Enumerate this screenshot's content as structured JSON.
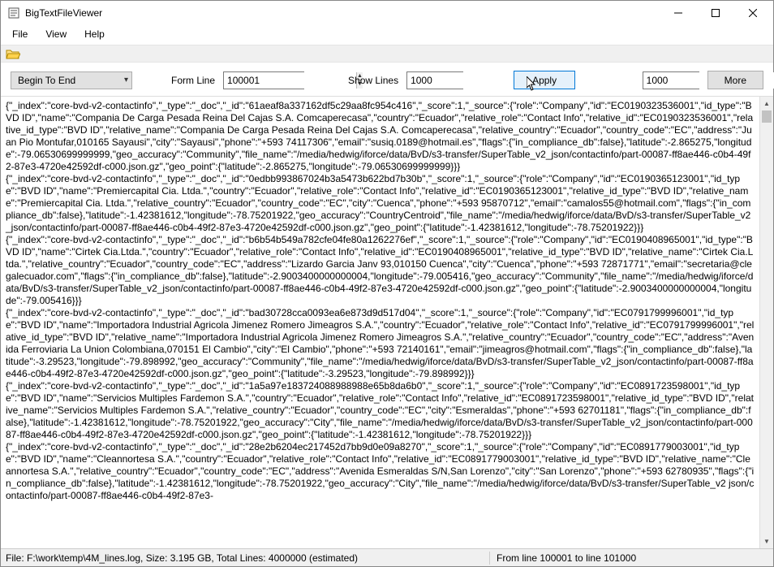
{
  "window": {
    "title": "BigTextFileViewer"
  },
  "menu": {
    "file": "File",
    "view": "View",
    "help": "Help"
  },
  "controls": {
    "direction_selected": "Begin To End",
    "form_line_label": "Form Line",
    "form_line_value": "100001",
    "show_lines_label": "Show Lines",
    "show_lines_value": "1000",
    "apply_label": "Apply",
    "right_spinner_value": "1000",
    "more_label": "More"
  },
  "content_text": "{\"_index\":\"core-bvd-v2-contactinfo\",\"_type\":\"_doc\",\"_id\":\"61aeaf8a337162df5c29aa8fc954c416\",\"_score\":1,\"_source\":{\"role\":\"Company\",\"id\":\"EC0190323536001\",\"id_type\":\"BVD ID\",\"name\":\"Compania De Carga Pesada Reina Del Cajas S.A. Comcaperecasa\",\"country\":\"Ecuador\",\"relative_role\":\"Contact Info\",\"relative_id\":\"EC0190323536001\",\"relative_id_type\":\"BVD ID\",\"relative_name\":\"Compania De Carga Pesada Reina Del Cajas S.A. Comcaperecasa\",\"relative_country\":\"Ecuador\",\"country_code\":\"EC\",\"address\":\"Juan Pio Montufar,010165 Sayausi\",\"city\":\"Sayausi\",\"phone\":\"+593 74117306\",\"email\":\"susiq.0189@hotmail.es\",\"flags\":{\"in_compliance_db\":false},\"latitude\":-2.865275,\"longitude\":-79.06530699999999,\"geo_accuracy\":\"Community\",\"file_name\":\"/media/hedwig/iforce/data/BvD/s3-transfer/SuperTable_v2_json/contactinfo/part-00087-ff8ae446-c0b4-49f2-87e3-4720e42592df-c000.json.gz\",\"geo_point\":{\"latitude\":-2.865275,\"longitude\":-79.06530699999999}}}\n{\"_index\":\"core-bvd-v2-contactinfo\",\"_type\":\"_doc\",\"_id\":\"0edbb993867024b3a5473b622bd7b30b\",\"_score\":1,\"_source\":{\"role\":\"Company\",\"id\":\"EC0190365123001\",\"id_type\":\"BVD ID\",\"name\":\"Premiercapital Cia. Ltda.\",\"country\":\"Ecuador\",\"relative_role\":\"Contact Info\",\"relative_id\":\"EC0190365123001\",\"relative_id_type\":\"BVD ID\",\"relative_name\":\"Premiercapital Cia. Ltda.\",\"relative_country\":\"Ecuador\",\"country_code\":\"EC\",\"city\":\"Cuenca\",\"phone\":\"+593 95870712\",\"email\":\"camalos55@hotmail.com\",\"flags\":{\"in_compliance_db\":false},\"latitude\":-1.42381612,\"longitude\":-78.75201922,\"geo_accuracy\":\"CountryCentroid\",\"file_name\":\"/media/hedwig/iforce/data/BvD/s3-transfer/SuperTable_v2_json/contactinfo/part-00087-ff8ae446-c0b4-49f2-87e3-4720e42592df-c000.json.gz\",\"geo_point\":{\"latitude\":-1.42381612,\"longitude\":-78.75201922}}}\n{\"_index\":\"core-bvd-v2-contactinfo\",\"_type\":\"_doc\",\"_id\":\"b6b54b549a782cfe04fe80a1262276ef\",\"_score\":1,\"_source\":{\"role\":\"Company\",\"id\":\"EC0190408965001\",\"id_type\":\"BVD ID\",\"name\":\"Cirtek Cia.Ltda.\",\"country\":\"Ecuador\",\"relative_role\":\"Contact Info\",\"relative_id\":\"EC0190408965001\",\"relative_id_type\":\"BVD ID\",\"relative_name\":\"Cirtek Cia.Ltda.\",\"relative_country\":\"Ecuador\",\"country_code\":\"EC\",\"address\":\"Lizardo Garcia Janv 93,010150 Cuenca\",\"city\":\"Cuenca\",\"phone\":\"+593 72871771\",\"email\":\"secretaria@clegalecuador.com\",\"flags\":{\"in_compliance_db\":false},\"latitude\":-2.9003400000000004,\"longitude\":-79.005416,\"geo_accuracy\":\"Community\",\"file_name\":\"/media/hedwig/iforce/data/BvD/s3-transfer/SuperTable_v2_json/contactinfo/part-00087-ff8ae446-c0b4-49f2-87e3-4720e42592df-c000.json.gz\",\"geo_point\":{\"latitude\":-2.9003400000000004,\"longitude\":-79.005416}}}\n{\"_index\":\"core-bvd-v2-contactinfo\",\"_type\":\"_doc\",\"_id\":\"bad30728cca0093ea6e873d9d517d04\",\"_score\":1,\"_source\":{\"role\":\"Company\",\"id\":\"EC0791799996001\",\"id_type\":\"BVD ID\",\"name\":\"Importadora Industrial Agricola Jimenez Romero Jimeagros S.A.\",\"country\":\"Ecuador\",\"relative_role\":\"Contact Info\",\"relative_id\":\"EC0791799996001\",\"relative_id_type\":\"BVD ID\",\"relative_name\":\"Importadora Industrial Agricola Jimenez Romero Jimeagros S.A.\",\"relative_country\":\"Ecuador\",\"country_code\":\"EC\",\"address\":\"Avenida Ferroviaria La Union Colombiana,070151 El Cambio\",\"city\":\"El Cambio\",\"phone\":\"+593 72140161\",\"email\":\"jimeagros@hotmail.com\",\"flags\":{\"in_compliance_db\":false},\"latitude\":-3.29523,\"longitude\":-79.898992,\"geo_accuracy\":\"Community\",\"file_name\":\"/media/hedwig/iforce/data/BvD/s3-transfer/SuperTable_v2_json/contactinfo/part-00087-ff8ae446-c0b4-49f2-87e3-4720e42592df-c000.json.gz\",\"geo_point\":{\"latitude\":-3.29523,\"longitude\":-79.898992}}}\n{\"_index\":\"core-bvd-v2-contactinfo\",\"_type\":\"_doc\",\"_id\":\"1a5a97e183724088988988e65b8da6b0\",\"_score\":1,\"_source\":{\"role\":\"Company\",\"id\":\"EC0891723598001\",\"id_type\":\"BVD ID\",\"name\":\"Servicios Multiples Fardemon S.A.\",\"country\":\"Ecuador\",\"relative_role\":\"Contact Info\",\"relative_id\":\"EC0891723598001\",\"relative_id_type\":\"BVD ID\",\"relative_name\":\"Servicios Multiples Fardemon S.A.\",\"relative_country\":\"Ecuador\",\"country_code\":\"EC\",\"city\":\"Esmeraldas\",\"phone\":\"+593 62701181\",\"flags\":{\"in_compliance_db\":false},\"latitude\":-1.42381612,\"longitude\":-78.75201922,\"geo_accuracy\":\"City\",\"file_name\":\"/media/hedwig/iforce/data/BvD/s3-transfer/SuperTable_v2_json/contactinfo/part-00087-ff8ae446-c0b4-49f2-87e3-4720e42592df-c000.json.gz\",\"geo_point\":{\"latitude\":-1.42381612,\"longitude\":-78.75201922}}}\n{\"_index\":\"core-bvd-v2-contactinfo\",\"_type\":\"_doc\",\"_id\":\"28e2b6204ec217452d7bb9d0e09a8270\",\"_score\":1,\"_source\":{\"role\":\"Company\",\"id\":\"EC0891779003001\",\"id_type\":\"BVD ID\",\"name\":\"Cleannortesa S.A.\",\"country\":\"Ecuador\",\"relative_role\":\"Contact Info\",\"relative_id\":\"EC0891779003001\",\"relative_id_type\":\"BVD ID\",\"relative_name\":\"Cleannortesa S.A.\",\"relative_country\":\"Ecuador\",\"country_code\":\"EC\",\"address\":\"Avenida Esmeraldas S/N,San Lorenzo\",\"city\":\"San Lorenzo\",\"phone\":\"+593 62780935\",\"flags\":{\"in_compliance_db\":false},\"latitude\":-1.42381612,\"longitude\":-78.75201922,\"geo_accuracy\":\"City\",\"file_name\":\"/media/hedwig/iforce/data/BvD/s3-transfer/SuperTable_v2 json/contactinfo/part-00087-ff8ae446-c0b4-49f2-87e3-",
  "status": {
    "left": "File: F:\\work\\temp\\4M_lines.log, Size:    3.195 GB, Total Lines: 4000000 (estimated)",
    "right": "From line 100001 to line 101000"
  }
}
